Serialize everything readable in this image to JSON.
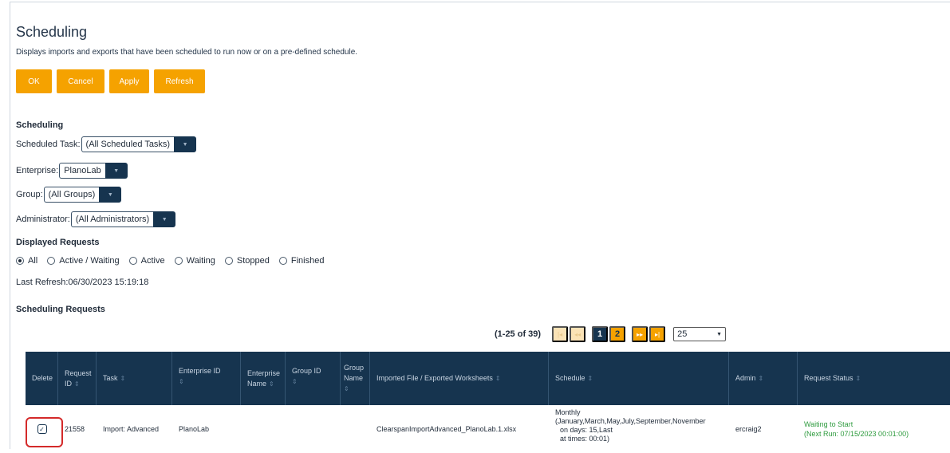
{
  "header": {
    "title": "Scheduling",
    "description": "Displays imports and exports that have been scheduled to run now or on a pre-defined schedule."
  },
  "buttons": {
    "ok": "OK",
    "cancel": "Cancel",
    "apply": "Apply",
    "refresh": "Refresh"
  },
  "filters": {
    "heading": "Scheduling",
    "scheduled_task": {
      "label": "Scheduled Task:",
      "value": "(All Scheduled Tasks)"
    },
    "enterprise": {
      "label": "Enterprise:",
      "value": "PlanoLab"
    },
    "group": {
      "label": "Group:",
      "value": "(All Groups)"
    },
    "administrator": {
      "label": "Administrator:",
      "value": "(All Administrators)"
    }
  },
  "displayed_requests": {
    "heading": "Displayed Requests",
    "options": [
      "All",
      "Active / Waiting",
      "Active",
      "Waiting",
      "Stopped",
      "Finished"
    ],
    "selected": "All"
  },
  "last_refresh": "Last Refresh:06/30/2023 15:19:18",
  "requests": {
    "heading": "Scheduling Requests",
    "pager": {
      "count": "(1-25 of 39)",
      "first": "|◂",
      "prev": "◂◂",
      "pages": [
        "1",
        "2"
      ],
      "current": "1",
      "next": "▸▸",
      "last": "▸|",
      "page_size": "25"
    },
    "columns": {
      "delete": "Delete",
      "request_id_1": "Request",
      "request_id_2": "ID",
      "task": "Task",
      "enterprise_id": "Enterprise ID",
      "enterprise_name_1": "Enterprise",
      "enterprise_name_2": "Name",
      "group_id": "Group ID",
      "group_name_1": "Group",
      "group_name_2": "Name",
      "imported_file": "Imported File / Exported Worksheets",
      "schedule": "Schedule",
      "admin": "Admin",
      "request_status": "Request Status"
    },
    "rows": [
      {
        "request_id": "21558",
        "task": "Import: Advanced",
        "enterprise_id": "PlanoLab",
        "enterprise_name": "",
        "group_id": "",
        "group_name": "",
        "file": "ClearspanImportAdvanced_PlanoLab.1.xlsx",
        "schedule_1": "Monthly",
        "schedule_2": "(January,March,May,July,September,November",
        "schedule_3": "on days: 15,Last",
        "schedule_4": "at times: 00:01)",
        "admin": "ercraig2",
        "status_1": "Waiting to Start",
        "status_2": "(Next Run: 07/15/2023 00:01:00)",
        "checked": true
      }
    ]
  },
  "colors": {
    "accent": "#f5a200",
    "navy": "#16344f",
    "status_green": "#2e9b3e",
    "highlight_red": "#d42a2a"
  }
}
